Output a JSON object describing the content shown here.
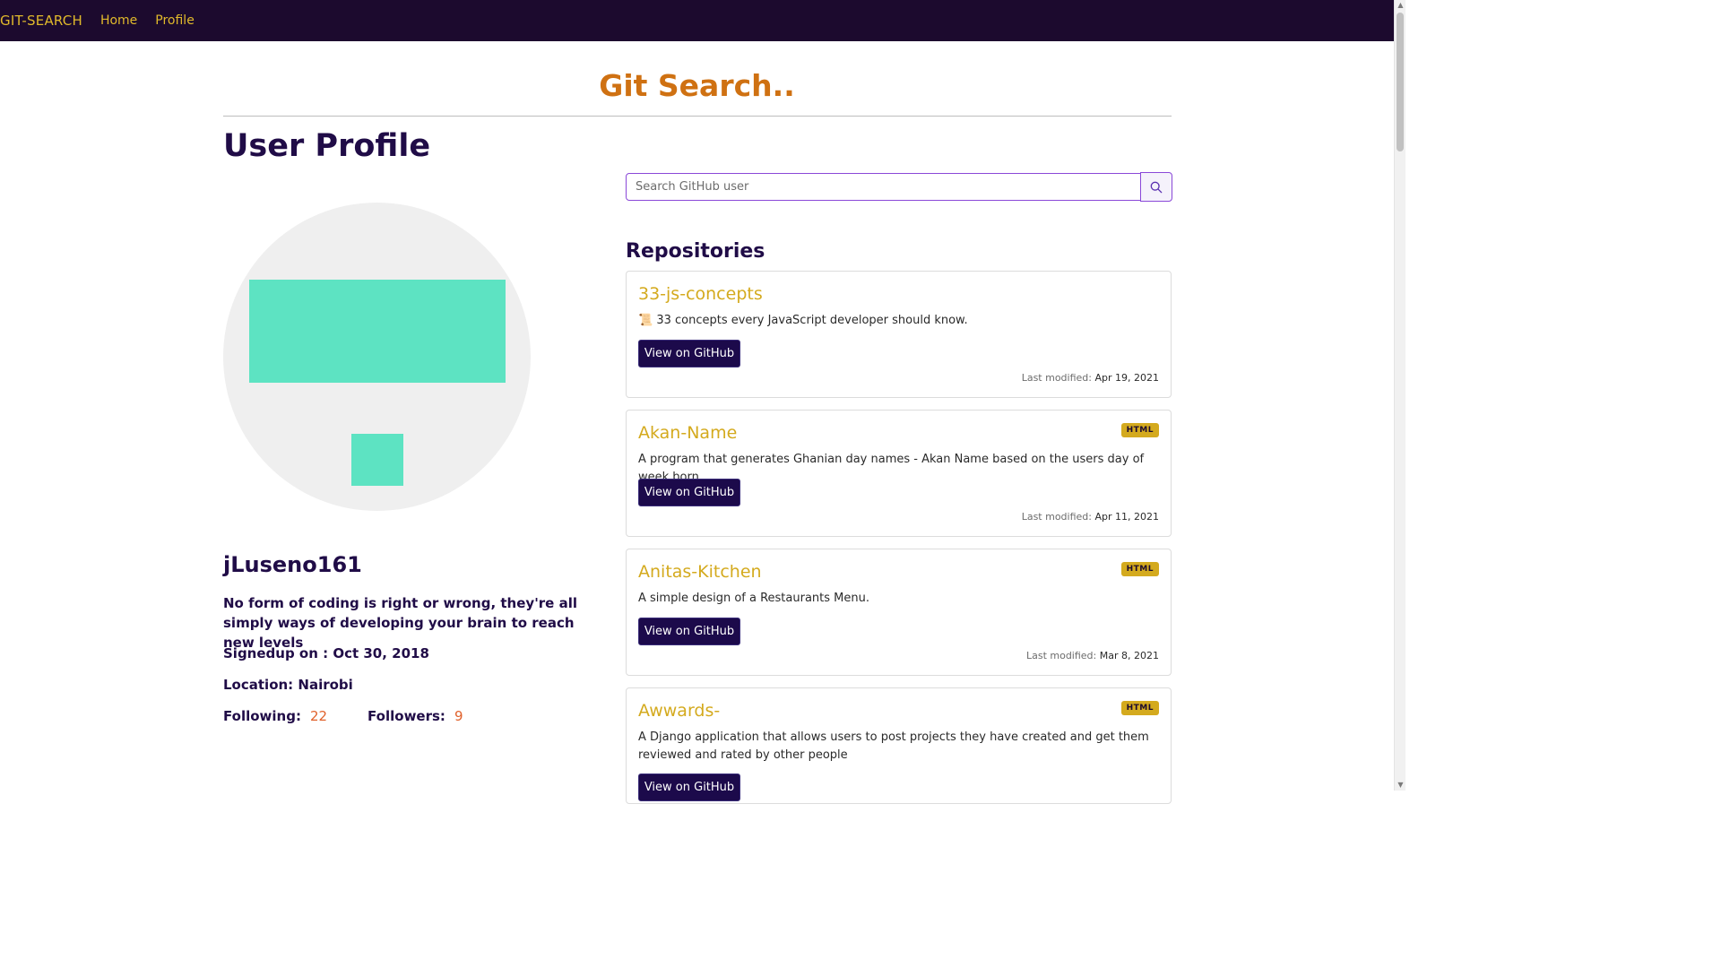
{
  "nav": {
    "brand": "GIT-SEARCH",
    "links": [
      "Home",
      "Profile"
    ]
  },
  "header": {
    "site_title": "Git Search.."
  },
  "profile": {
    "heading": "User Profile",
    "username": "jLuseno161",
    "bio": "No form of coding is right or wrong, they're all simply ways of developing your brain to reach new levels",
    "signup": "Signedup on : Oct 30, 2018",
    "location": "Location: Nairobi",
    "following_label": "Following:",
    "following_value": "22",
    "followers_label": "Followers:",
    "followers_value": "9"
  },
  "search": {
    "placeholder": "Search GitHub user",
    "icon": "search-icon"
  },
  "repositories": {
    "heading": "Repositories",
    "last_modified_label": "Last modified:",
    "button_label": "View on GitHub",
    "items": [
      {
        "name": "33-js-concepts",
        "badge": "",
        "description": "📜 33 concepts every JavaScript developer should know.",
        "modified": "Apr 19, 2021"
      },
      {
        "name": "Akan-Name",
        "badge": "HTML",
        "description": "A program that generates Ghanian day names - Akan Name based on the users day of week born.",
        "modified": "Apr 11, 2021"
      },
      {
        "name": "Anitas-Kitchen",
        "badge": "HTML",
        "description": "A simple design of a Restaurants Menu.",
        "modified": "Mar 8, 2021"
      },
      {
        "name": "Awwards-",
        "badge": "HTML",
        "description": "A Django application that allows users to post projects they have created and get them reviewed and rated by other people",
        "modified": ""
      }
    ]
  },
  "colors": {
    "navbar": "#1c0a2e",
    "accent_gold": "#d4aa1e",
    "title_orange": "#cf7112",
    "heading_purple": "#200c47",
    "avatar_teal": "#5de3c2"
  }
}
